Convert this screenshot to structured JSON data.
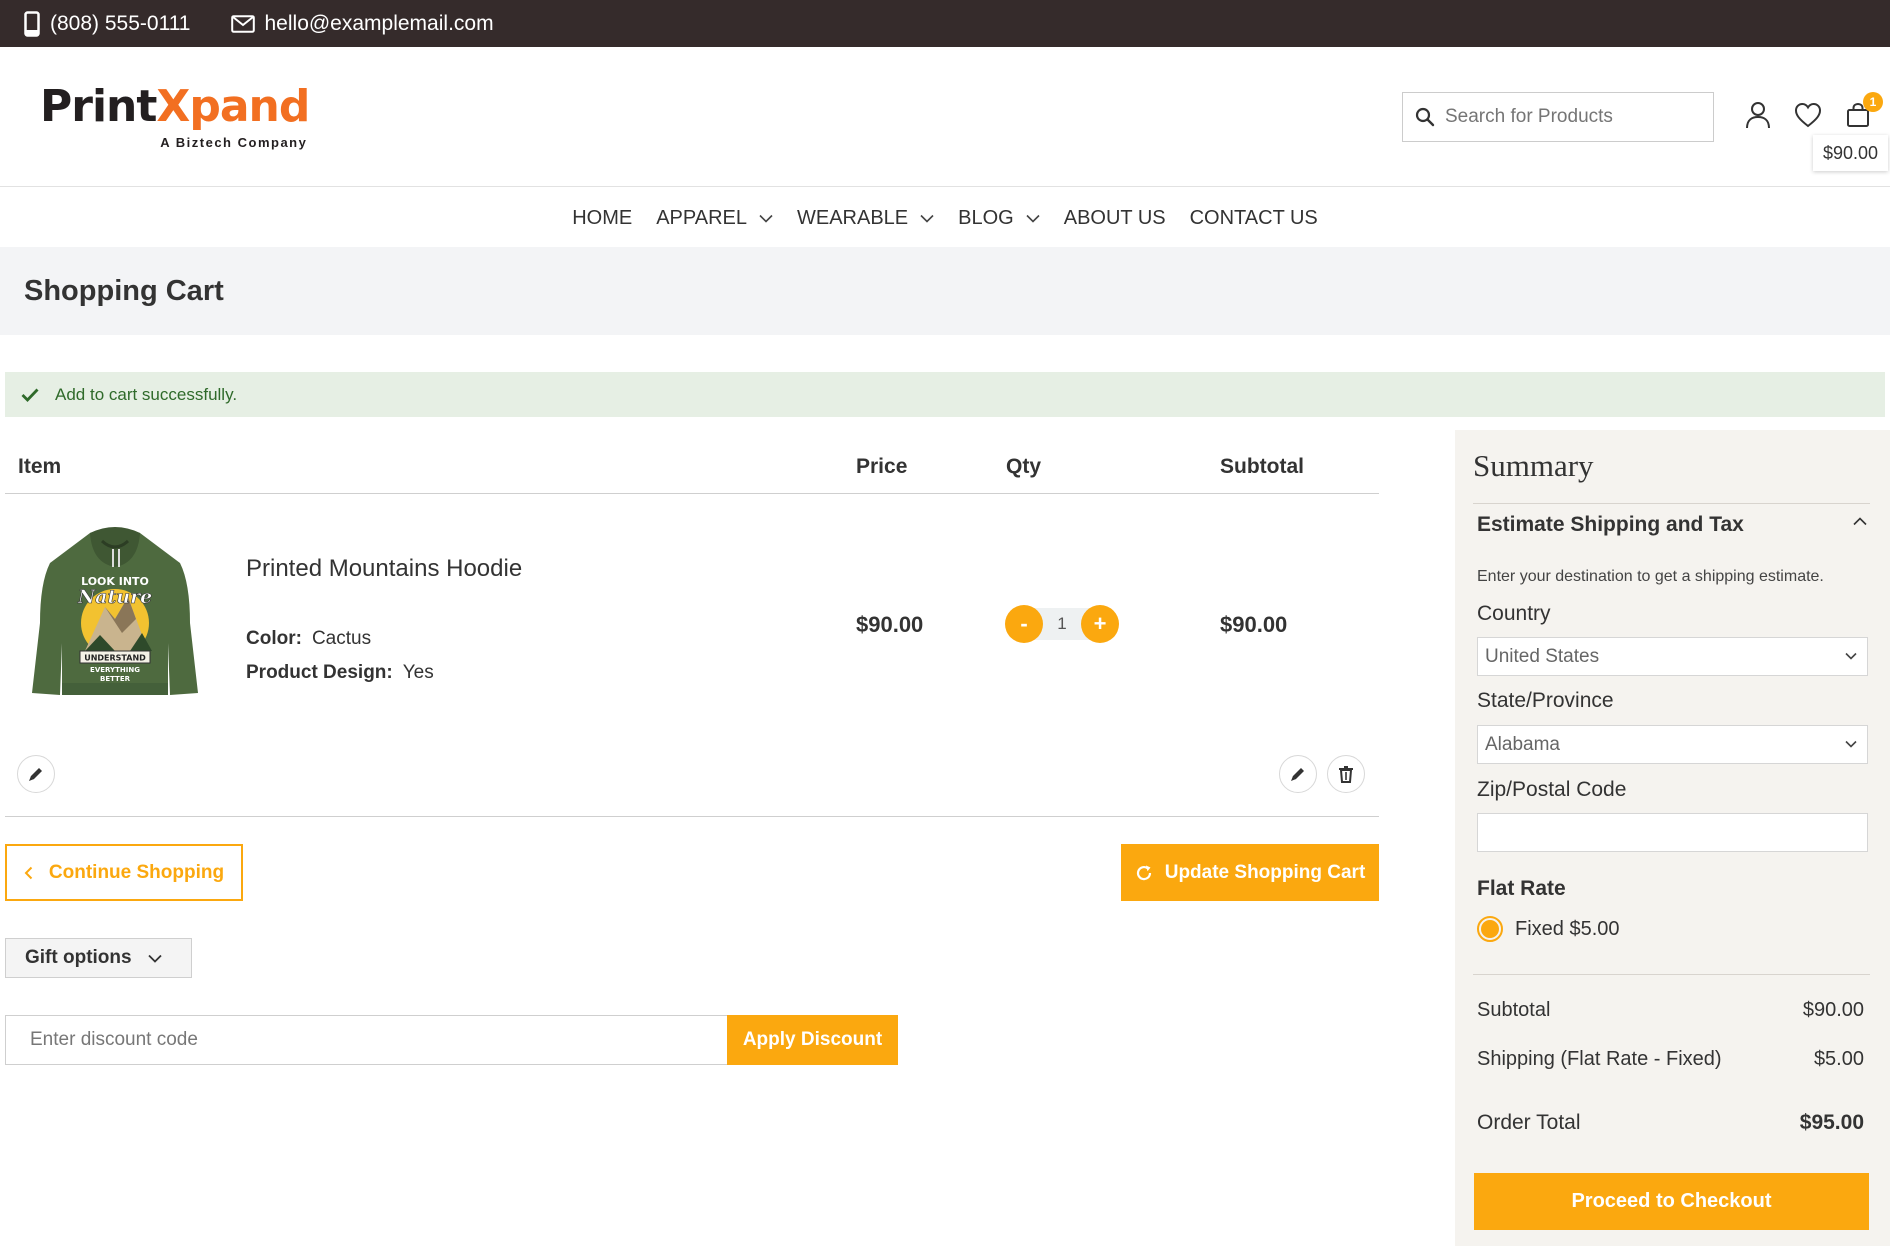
{
  "topbar": {
    "phone": "(808) 555-0111",
    "email": "hello@examplemail.com"
  },
  "header": {
    "logo_part1": "Print",
    "logo_x": "X",
    "logo_part2": "pand",
    "logo_tagline": "A Biztech Company",
    "search_placeholder": "Search for Products",
    "cart_count": "1",
    "cart_total": "$90.00"
  },
  "nav": {
    "items": [
      {
        "label": "HOME",
        "dropdown": false
      },
      {
        "label": "APPAREL",
        "dropdown": true
      },
      {
        "label": "WEARABLE",
        "dropdown": true
      },
      {
        "label": "BLOG",
        "dropdown": true
      },
      {
        "label": "ABOUT US",
        "dropdown": false
      },
      {
        "label": "CONTACT US",
        "dropdown": false
      }
    ]
  },
  "page": {
    "title": "Shopping Cart",
    "message": "Add to cart successfully."
  },
  "cart": {
    "headers": {
      "item": "Item",
      "price": "Price",
      "qty": "Qty",
      "subtotal": "Subtotal"
    },
    "items": [
      {
        "name": "Printed Mountains Hoodie",
        "options": [
          {
            "label": "Color:",
            "value": "Cactus"
          },
          {
            "label": "Product Design:",
            "value": "Yes"
          }
        ],
        "price": "$90.00",
        "qty": "1",
        "subtotal": "$90.00",
        "image_text": {
          "top": "LOOK INTO",
          "script": "Nature",
          "banner": "UNDERSTAND",
          "bottom1": "EVERYTHING",
          "bottom2": "BETTER"
        }
      }
    ],
    "qty_minus": "-",
    "qty_plus": "+",
    "continue_label": "Continue Shopping",
    "update_label": "Update Shopping Cart",
    "gift_label": "Gift options",
    "discount_placeholder": "Enter discount code",
    "apply_label": "Apply Discount"
  },
  "summary": {
    "title": "Summary",
    "estimate_title": "Estimate Shipping and Tax",
    "estimate_hint": "Enter your destination to get a shipping estimate.",
    "country_label": "Country",
    "country_value": "United States",
    "state_label": "State/Province",
    "state_value": "Alabama",
    "zip_label": "Zip/Postal Code",
    "flat_rate_title": "Flat Rate",
    "flat_rate_option": "Fixed $5.00",
    "subtotal_label": "Subtotal",
    "subtotal_value": "$90.00",
    "shipping_label": "Shipping (Flat Rate - Fixed)",
    "shipping_value": "$5.00",
    "order_total_label": "Order Total",
    "order_total_value": "$95.00",
    "checkout_label": "Proceed to Checkout"
  },
  "colors": {
    "accent": "#fba80f",
    "topbar": "#352b2b",
    "brand_orange": "#f26f21",
    "success_bg": "#e6efe4"
  },
  "icons": [
    "phone-icon",
    "mail-icon",
    "search-icon",
    "user-icon",
    "heart-icon",
    "cart-icon",
    "chevron-down-icon",
    "checkmark-icon",
    "pencil-icon",
    "trash-icon",
    "chevron-left-icon",
    "refresh-icon",
    "chevron-up-icon"
  ]
}
